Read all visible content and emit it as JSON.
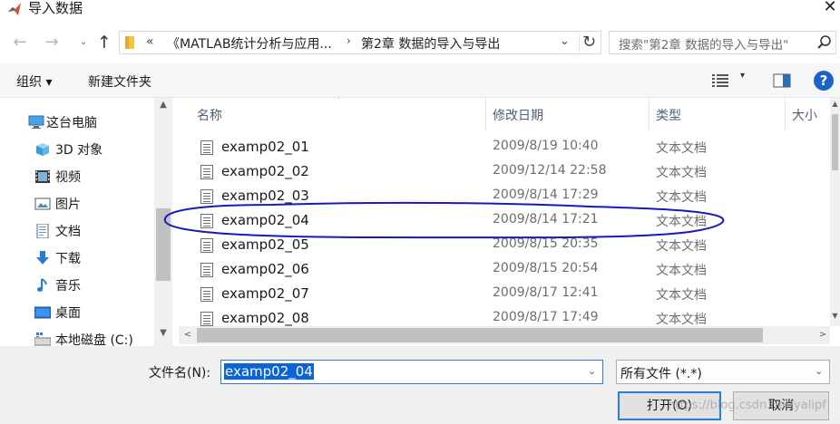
{
  "window": {
    "title": "导入数据",
    "close_glyph": "✕"
  },
  "nav": {
    "back_glyph": "←",
    "forward_glyph": "→",
    "recent_glyph": "⌄",
    "up_glyph": "↑"
  },
  "address": {
    "overflow": "«",
    "segment1": "《MATLAB统计分析与应用...",
    "separator": "›",
    "segment2": "第2章 数据的导入与导出",
    "dropdown_glyph": "⌄",
    "refresh_glyph": "↻"
  },
  "search": {
    "placeholder": "搜索\"第2章 数据的导入与导出\""
  },
  "toolbar": {
    "organize": "组织 ▾",
    "new_folder": "新建文件夹",
    "view_arrow": "▾",
    "help": "?"
  },
  "sidebar": {
    "items": [
      {
        "label": "这台电脑",
        "icon": "computer-icon"
      },
      {
        "label": "3D 对象",
        "icon": "3d-objects-icon"
      },
      {
        "label": "视频",
        "icon": "video-icon"
      },
      {
        "label": "图片",
        "icon": "pictures-icon"
      },
      {
        "label": "文档",
        "icon": "documents-icon"
      },
      {
        "label": "下载",
        "icon": "download-icon"
      },
      {
        "label": "音乐",
        "icon": "music-icon"
      },
      {
        "label": "桌面",
        "icon": "desktop-icon"
      },
      {
        "label": "本地磁盘 (C:)",
        "icon": "drive-icon"
      }
    ]
  },
  "filelist": {
    "columns": {
      "name": "名称",
      "modified": "修改日期",
      "type": "类型",
      "size": "大小"
    },
    "sort_glyph": "^",
    "rows": [
      {
        "name": "examp02_01",
        "date": "2009/8/19 10:40",
        "type": "文本文档"
      },
      {
        "name": "examp02_02",
        "date": "2009/12/14 22:58",
        "type": "文本文档"
      },
      {
        "name": "examp02_03",
        "date": "2009/8/14 17:29",
        "type": "文本文档"
      },
      {
        "name": "examp02_04",
        "date": "2009/8/14 17:21",
        "type": "文本文档"
      },
      {
        "name": "examp02_05",
        "date": "2009/8/15 20:35",
        "type": "文本文档"
      },
      {
        "name": "examp02_06",
        "date": "2009/8/15 20:54",
        "type": "文本文档"
      },
      {
        "name": "examp02_07",
        "date": "2009/8/17 12:41",
        "type": "文本文档"
      },
      {
        "name": "examp02_08",
        "date": "2009/8/17 17:49",
        "type": "文本文档"
      }
    ]
  },
  "scroll": {
    "up": "▲",
    "down": "▼",
    "left": "<",
    "right": ">"
  },
  "footer": {
    "filename_label": "文件名(N):",
    "filename_value": "examp02_04",
    "filename_dropdown": "⌄",
    "filter_value": "所有文件 (*.*)",
    "filter_dropdown": "⌄",
    "open_button": "打开(O)",
    "cancel_button": "取消",
    "watermark": "https://blog.csdn.net/yalipf"
  },
  "colors": {
    "accent": "#0a64d6",
    "annotation": "#1a1ab8",
    "help": "#1b63c6"
  }
}
